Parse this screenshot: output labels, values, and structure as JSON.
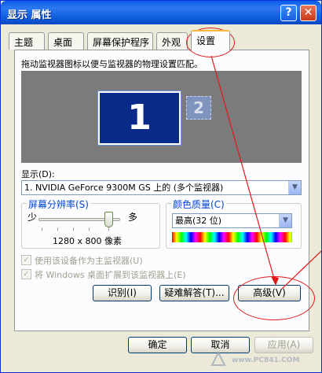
{
  "window": {
    "title": "显示 属性",
    "help_label": "?",
    "close_label": "✕"
  },
  "tabs": [
    {
      "label": "主题"
    },
    {
      "label": "桌面"
    },
    {
      "label": "屏幕保护程序"
    },
    {
      "label": "外观"
    },
    {
      "label": "设置",
      "active": true
    }
  ],
  "settings": {
    "instruction": "拖动监视器图标以便与监视器的物理设置匹配。",
    "monitors": [
      {
        "number": "1"
      },
      {
        "number": "2"
      }
    ],
    "display_label": "显示(D):",
    "display_value": "1. NVIDIA GeForce 9300M GS 上的 (多个监视器)",
    "resolution": {
      "group_title": "屏幕分辨率(S)",
      "less_label": "少",
      "more_label": "多",
      "value": "1280 x 800 像素"
    },
    "color_quality": {
      "group_title": "颜色质量(C)",
      "value": "最高(32 位)"
    },
    "primary_checkbox_label": "使用该设备作为主监视器(U)",
    "extend_checkbox_label": "将 Windows 桌面扩展到该监视器上(E)",
    "identify_button": "识别(I)",
    "troubleshoot_button": "疑难解答(T)...",
    "advanced_button": "高级(V)"
  },
  "footer": {
    "ok_button": "确定",
    "cancel_button": "取消",
    "apply_button": "应用(A)"
  },
  "watermark": {
    "site": "www.PC841.COM"
  },
  "colors": {
    "titlebar": "#0a5ce8",
    "window_bg": "#ece9d8",
    "annotation": "#e01818",
    "monitor_bg": "#0a2a8a"
  }
}
